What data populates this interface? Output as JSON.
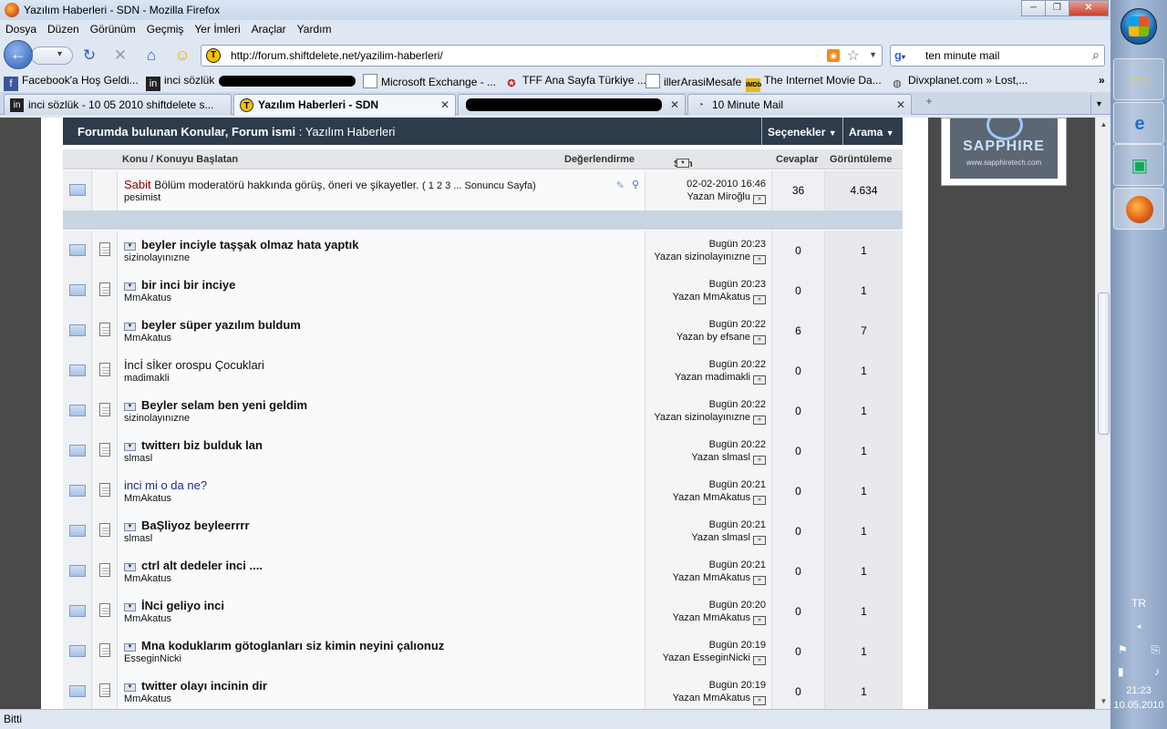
{
  "window": {
    "title": "Yazılım Haberleri - SDN - Mozilla Firefox",
    "min": "─",
    "max": "❐",
    "close": "✕"
  },
  "menu": [
    "Dosya",
    "Düzen",
    "Görünüm",
    "Geçmiş",
    "Yer İmleri",
    "Araçlar",
    "Yardım"
  ],
  "nav": {
    "url": "http://forum.shiftdelete.net/yazilim-haberleri/",
    "search_value": "ten minute mail"
  },
  "bookmarks": [
    "Facebook'a Hoş Geldi...",
    "inci sözlük",
    "Microsoft Exchange - ...",
    "TFF Ana Sayfa Türkiye ...",
    "illerArasiMesafe",
    "The Internet Movie Da...",
    "Divxplanet.com » Lost,..."
  ],
  "tabs": [
    {
      "label": "inci sözlük - 10 05 2010 shiftdelete s...",
      "active": false
    },
    {
      "label": "Yazılım Haberleri - SDN",
      "active": true
    },
    {
      "label": "10 Minute Mail",
      "active": false
    }
  ],
  "forum": {
    "header_title": "Forumda bulunan Konular, Forum ismi",
    "header_forum": ": Yazılım Haberleri",
    "options_label": "Seçenekler",
    "search_label": "Arama",
    "col_topic": "Konu / Konuyu Başlatan",
    "col_rating": "Değerlendirme",
    "col_last": "Son Mesaj",
    "col_replies": "Cevaplar",
    "col_views": "Görüntüleme",
    "sticky": {
      "prefix": "Sabit",
      "title": "Bölüm moderatörü hakkında görüş, öneri ve şikayetler.",
      "pages": "( 1 2 3 ... Sonuncu Sayfa)",
      "author": "pesimist",
      "date": "02-02-2010 16:46",
      "by": "Yazan Miroğlu",
      "replies": "36",
      "views": "4.634"
    },
    "threads": [
      {
        "title": "beyler inciyle taşşak olmaz hata yaptık",
        "author": "sizinolayınızne",
        "time": "Bugün 20:23",
        "by": "Yazan sizinolayınızne",
        "replies": "0",
        "views": "1",
        "style": "bold"
      },
      {
        "title": "bir inci bir inciye",
        "author": "MmAkatus",
        "time": "Bugün 20:23",
        "by": "Yazan MmAkatus",
        "replies": "0",
        "views": "1",
        "style": "bold"
      },
      {
        "title": "beyler süper yazılım buldum",
        "author": "MmAkatus",
        "time": "Bugün 20:22",
        "by": "Yazan by efsane",
        "replies": "6",
        "views": "7",
        "style": "bold"
      },
      {
        "title": "İncİ sİker orospu Çocuklari",
        "author": "madimakli",
        "time": "Bugün 20:22",
        "by": "Yazan madimakli",
        "replies": "0",
        "views": "1",
        "style": "plain"
      },
      {
        "title": "Beyler selam ben yeni geldim",
        "author": "sizinolayınızne",
        "time": "Bugün 20:22",
        "by": "Yazan sizinolayınızne",
        "replies": "0",
        "views": "1",
        "style": "bold"
      },
      {
        "title": "twitterı biz bulduk lan",
        "author": "slmasl",
        "time": "Bugün 20:22",
        "by": "Yazan slmasl",
        "replies": "0",
        "views": "1",
        "style": "bold"
      },
      {
        "title": "inci mi o da ne?",
        "author": "MmAkatus",
        "time": "Bugün 20:21",
        "by": "Yazan MmAkatus",
        "replies": "0",
        "views": "1",
        "style": "link"
      },
      {
        "title": "BaŞliyoz beyleerrrr",
        "author": "slmasl",
        "time": "Bugün 20:21",
        "by": "Yazan slmasl",
        "replies": "0",
        "views": "1",
        "style": "bold"
      },
      {
        "title": "ctrl alt dedeler inci ....",
        "author": "MmAkatus",
        "time": "Bugün 20:21",
        "by": "Yazan MmAkatus",
        "replies": "0",
        "views": "1",
        "style": "bold"
      },
      {
        "title": "İNci geliyo inci",
        "author": "MmAkatus",
        "time": "Bugün 20:20",
        "by": "Yazan MmAkatus",
        "replies": "0",
        "views": "1",
        "style": "bold"
      },
      {
        "title": "Mna koduklarım götoglanları siz kimin neyini çalıonuz",
        "author": "EsseginNicki",
        "time": "Bugün 20:19",
        "by": "Yazan EsseginNicki",
        "replies": "0",
        "views": "1",
        "style": "bold"
      },
      {
        "title": "twitter olayı incinin dir",
        "author": "MmAkatus",
        "time": "Bugün 20:19",
        "by": "Yazan MmAkatus",
        "replies": "0",
        "views": "1",
        "style": "bold"
      }
    ]
  },
  "ad": {
    "brand": "SAPPHIRE",
    "url": "www.sapphiretech.com"
  },
  "status": "Bitti",
  "taskbar": {
    "lang": "TR",
    "time": "21:23",
    "date": "10.05.2010"
  }
}
